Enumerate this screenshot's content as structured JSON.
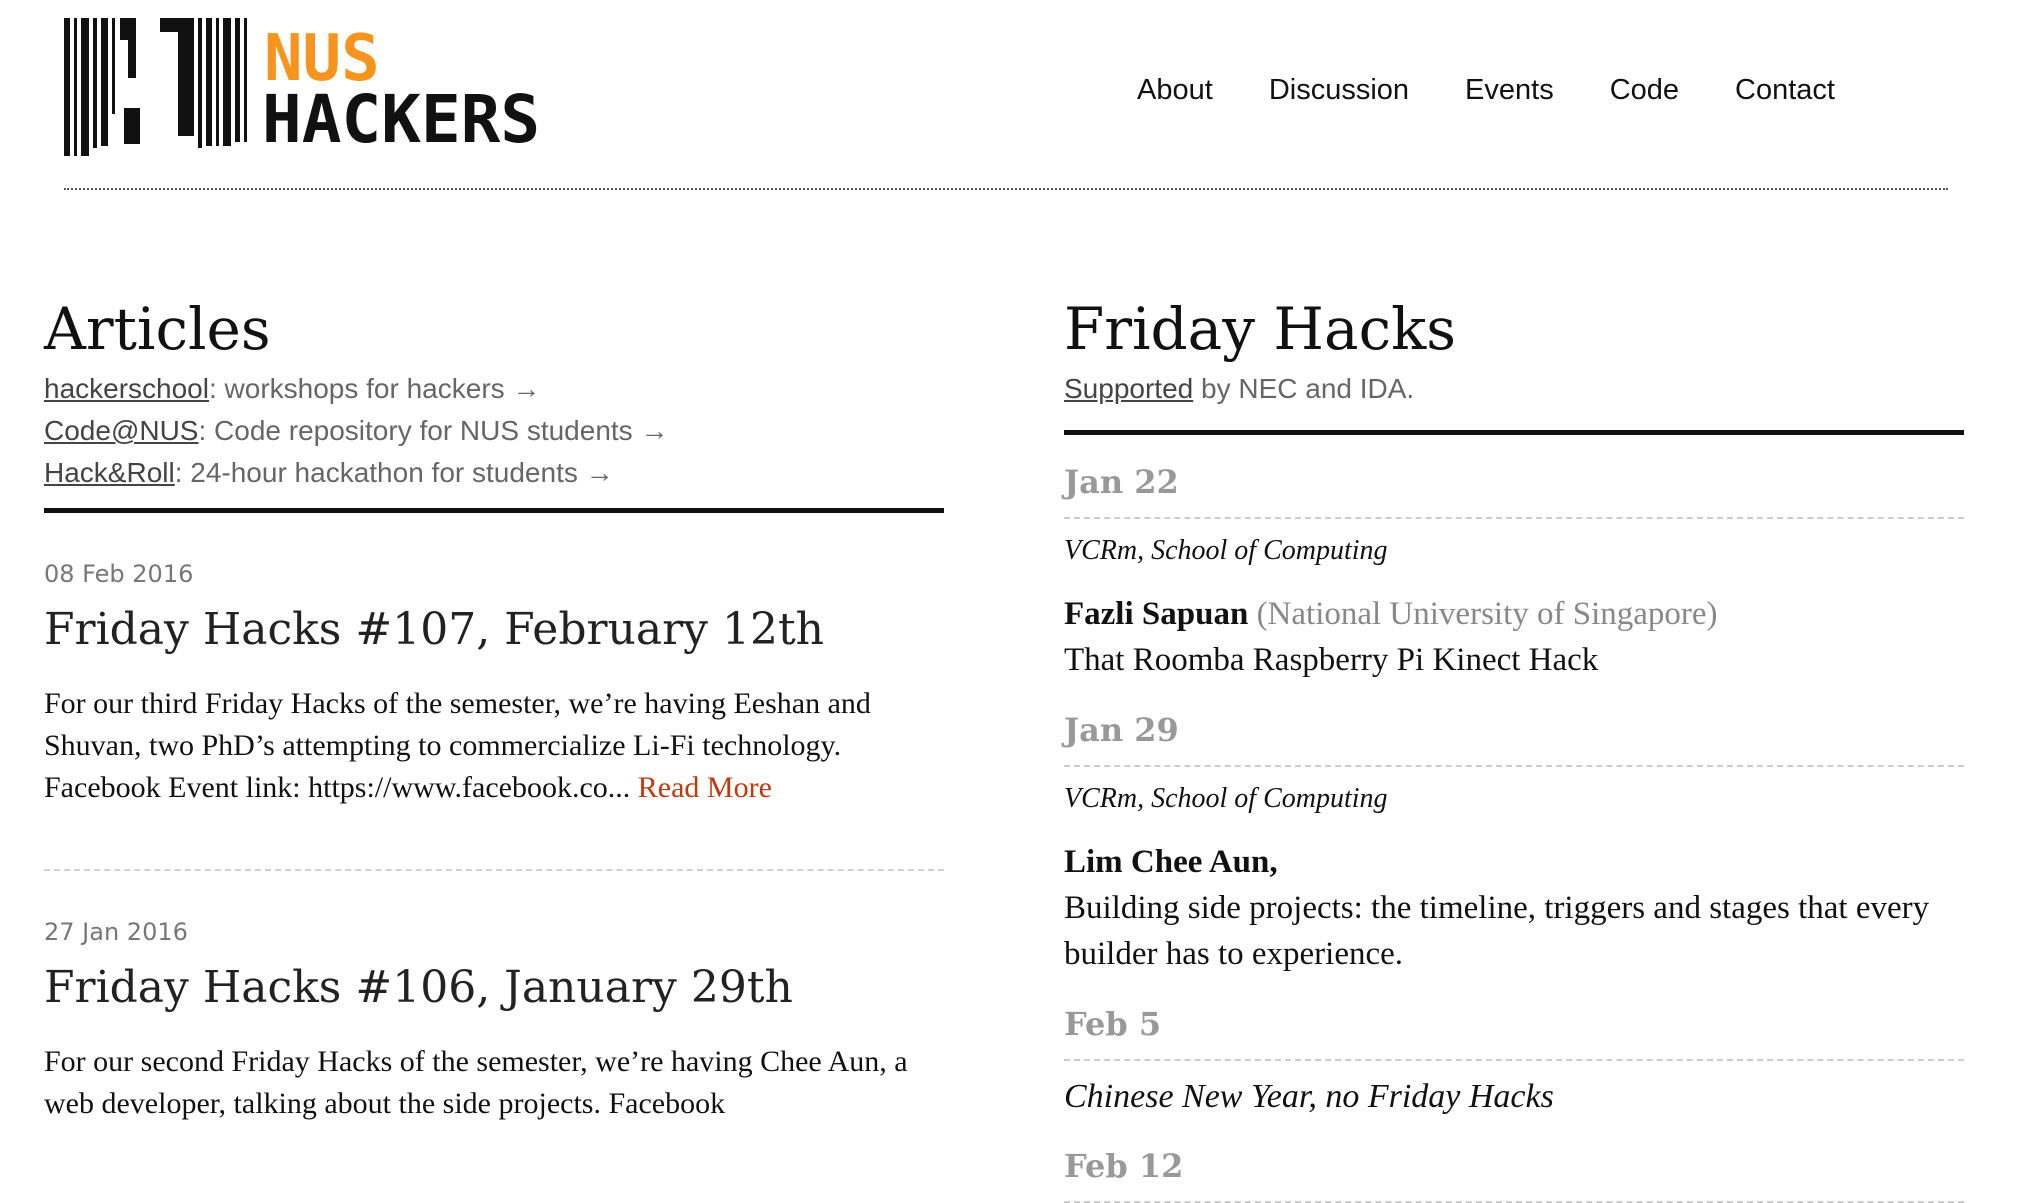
{
  "brand": {
    "logo_top": "NUS",
    "logo_bottom": "HACKERS",
    "accent": "#f7941d"
  },
  "nav": [
    "About",
    "Discussion",
    "Events",
    "Code",
    "Contact"
  ],
  "articles": {
    "heading": "Articles",
    "links": [
      {
        "name": "hackerschool",
        "desc": ": workshops for hackers →"
      },
      {
        "name": "Code@NUS",
        "desc": ": Code repository for NUS students →"
      },
      {
        "name": "Hack&Roll",
        "desc": ": 24-hour hackathon for students →"
      }
    ],
    "posts": [
      {
        "date": "08 Feb 2016",
        "title": "Friday Hacks #107, February 12th",
        "excerpt": "For our third Friday Hacks of the semester, we’re having Eeshan and Shuvan, two PhD’s attempting to commercialize Li-Fi technology. Facebook Event link: https://www.facebook.co...",
        "more": "Read More"
      },
      {
        "date": "27 Jan 2016",
        "title": "Friday Hacks #106, January 29th",
        "excerpt": "For our second Friday Hacks of the semester, we’re having Chee Aun, a web developer, talking about the side projects. Facebook"
      }
    ]
  },
  "friday": {
    "heading": "Friday Hacks",
    "supported_link": "Supported",
    "supported_rest": " by NEC and IDA.",
    "events": [
      {
        "date": "Jan 22",
        "venue": "VCRm, School of Computing",
        "speaker": "Fazli Sapuan",
        "affiliation": "(National University of Singapore)",
        "talk": "That Roomba Raspberry Pi Kinect Hack"
      },
      {
        "date": "Jan 29",
        "venue": "VCRm, School of Computing",
        "speaker": "Lim Chee Aun,",
        "affiliation": "",
        "talk": "Building side projects: the timeline, triggers and stages that every builder has to experience."
      },
      {
        "date": "Feb 5",
        "note": "Chinese New Year, no Friday Hacks"
      },
      {
        "date": "Feb 12"
      }
    ]
  }
}
